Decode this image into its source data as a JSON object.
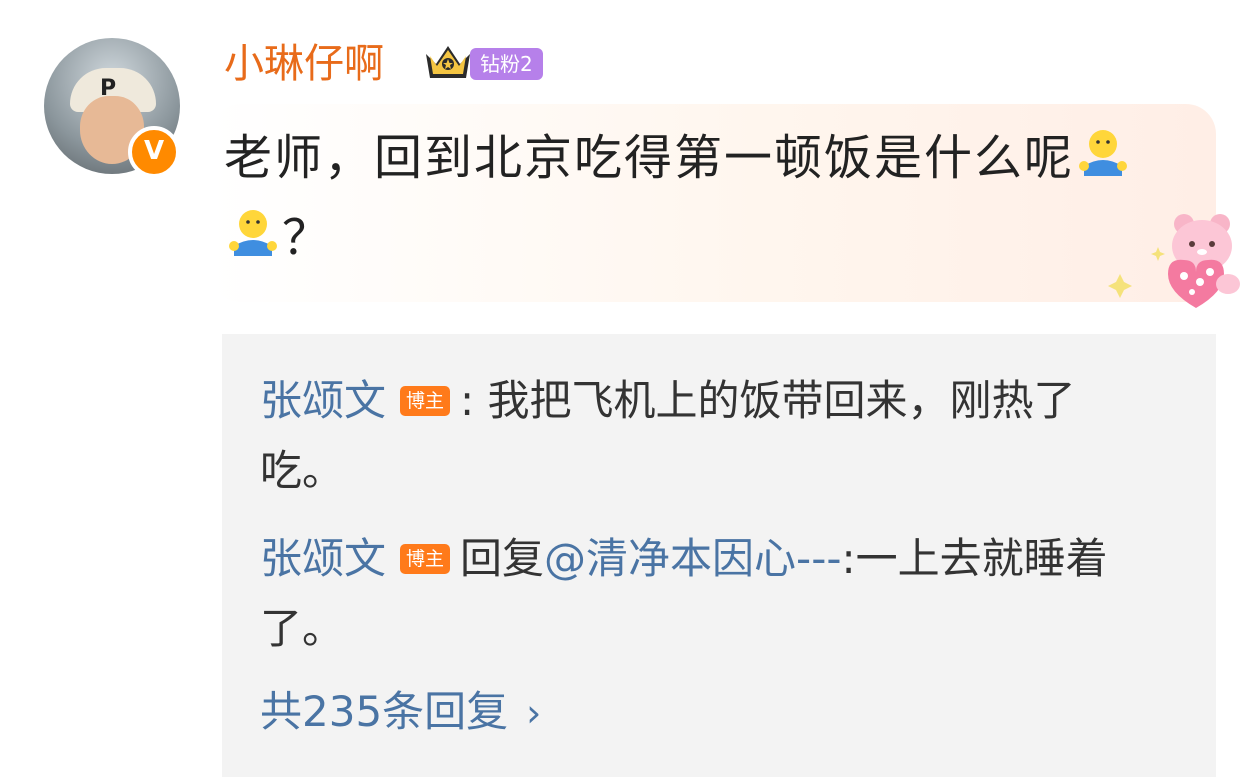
{
  "comment": {
    "username": "小琳仔啊",
    "fan_badge": "钻粉2",
    "verified_mark": "V",
    "text_part1": "老师，回到北京吃得第一顿饭是什么呢",
    "text_part2": "？",
    "emojis": [
      "hug-emoji",
      "hug-emoji"
    ]
  },
  "replies": [
    {
      "author": "张颂文",
      "badge": "博主",
      "separator": ":",
      "text": " 我把飞机上的饭带回来，刚热了吃。"
    },
    {
      "author": "张颂文",
      "badge": "博主",
      "reply_prefix": "回复",
      "mention": "@清净本因心---",
      "text": ":一上去就睡着了。"
    }
  ],
  "more_replies": {
    "label": "共235条回复",
    "icon": "chevron-right-icon"
  },
  "colors": {
    "username": "#e86b1a",
    "reply_name": "#4a74a4",
    "badge_bozhu": "#ff7a1a",
    "badge_fan": "#b680ea",
    "reply_bg": "#f3f3f3"
  }
}
